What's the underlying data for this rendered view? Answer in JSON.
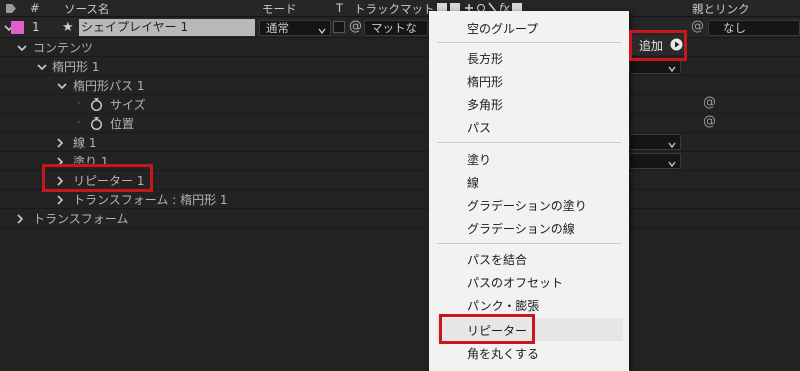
{
  "header": {
    "hash": "#",
    "source_name": "ソース名",
    "mode": "モード",
    "t": "T",
    "track_matte": "トラックマット",
    "fx": "fx",
    "parent_link": "親とリンク"
  },
  "layer": {
    "number": "1",
    "name": "シェイプレイヤー 1",
    "mode_value": "通常",
    "matte_value": "マットな",
    "parent_value": "なし",
    "label_color": "#e060c8"
  },
  "tree": {
    "contents": "コンテンツ",
    "ellipse": "楕円形 1",
    "ellipse_path": "楕円形パス 1",
    "size": "サイズ",
    "position": "位置",
    "stroke": "線 1",
    "fill": "塗り 1",
    "repeater": "リピーター 1",
    "transform_ellipse": "トランスフォーム : 楕円形 1",
    "transform": "トランスフォーム"
  },
  "add_button": {
    "label": "追加"
  },
  "menu": {
    "items": [
      "空のグループ",
      "長方形",
      "楕円形",
      "多角形",
      "パス",
      "塗り",
      "線",
      "グラデーションの塗り",
      "グラデーションの線",
      "パスを結合",
      "パスのオフセット",
      "パンク・膨張",
      "リピーター",
      "角を丸くする"
    ]
  },
  "colors": {
    "highlight": "#c8161d",
    "menu_bg": "#f2f2f2",
    "panel_bg": "#232323"
  }
}
